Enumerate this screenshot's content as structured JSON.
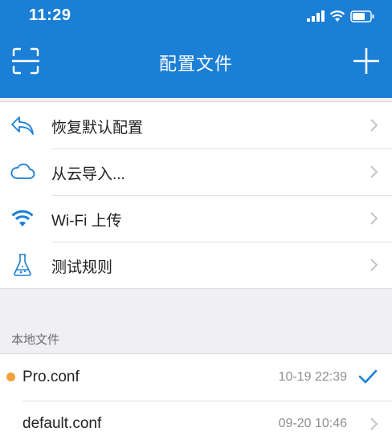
{
  "status": {
    "time": "11:29"
  },
  "nav": {
    "title": "配置文件",
    "left_icon": "scan-icon",
    "right_icon": "plus-icon"
  },
  "menu": [
    {
      "label": "恢复默认配置",
      "icon": "reply-icon"
    },
    {
      "label": "从云导入...",
      "icon": "cloud-icon"
    },
    {
      "label": "Wi-Fi 上传",
      "icon": "wifi-icon"
    },
    {
      "label": "测试规则",
      "icon": "flask-icon"
    }
  ],
  "local": {
    "header": "本地文件",
    "files": [
      {
        "name": "Pro.conf",
        "time": "10-19 22:39",
        "selected": true
      },
      {
        "name": "default.conf",
        "time": "09-20 10:46",
        "selected": false
      }
    ]
  },
  "colors": {
    "accent": "#1b7fd6",
    "active_dot": "#f3a036",
    "background": "#efeff4"
  }
}
